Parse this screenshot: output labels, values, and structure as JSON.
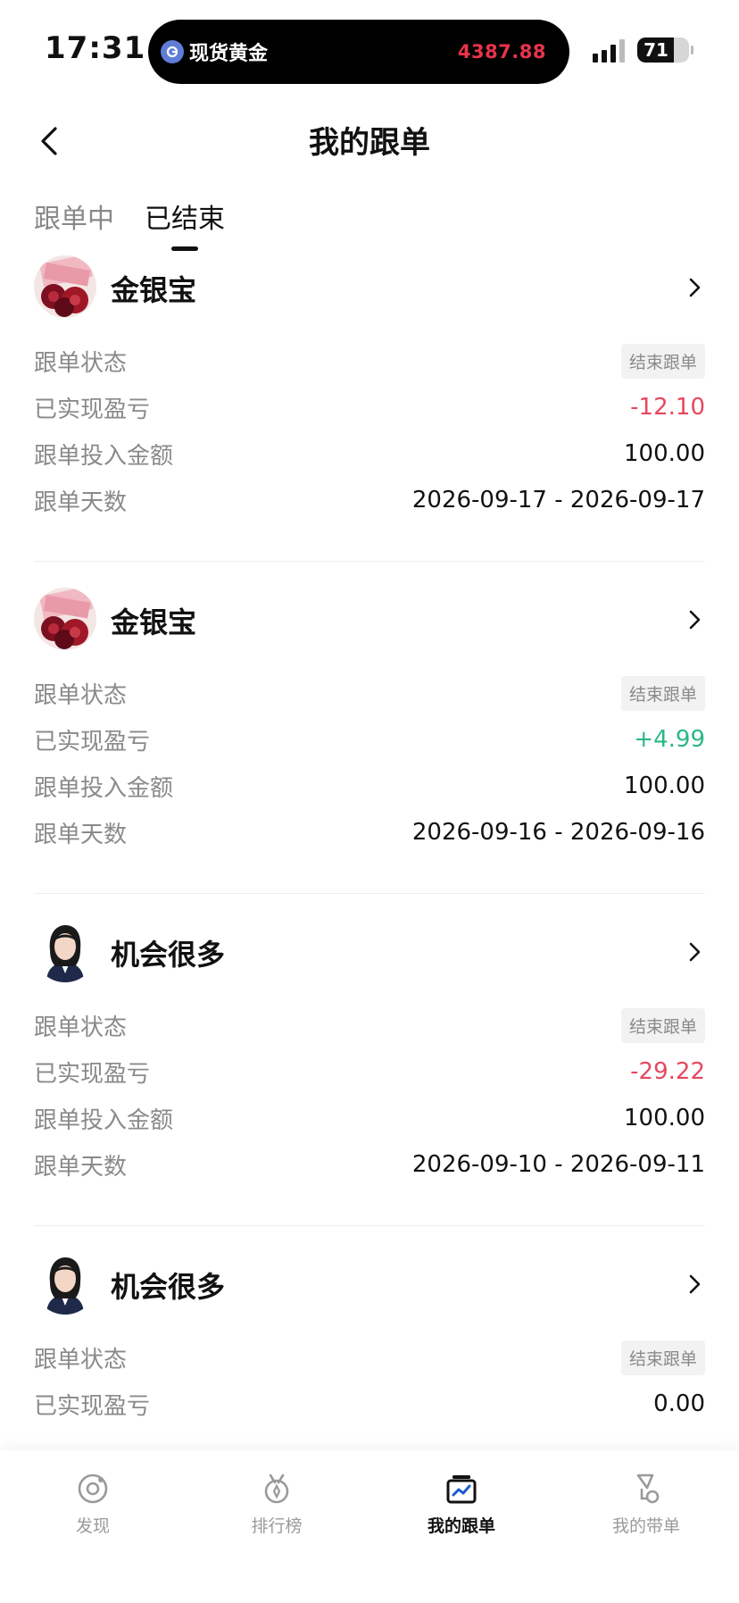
{
  "status_bar": {
    "time": "17:31",
    "island_title": "现货黄金",
    "island_price": "4387.88",
    "battery_level": "71",
    "battery_fraction": 0.71
  },
  "header": {
    "title": "我的跟单"
  },
  "tabs": {
    "ongoing": "跟单中",
    "ended": "已结束",
    "active": "ended"
  },
  "labels": {
    "status": "跟单状态",
    "pnl": "已实现盈亏",
    "amount": "跟单投入金额",
    "days": "跟单天数"
  },
  "cards": [
    {
      "name": "金银宝",
      "avatar": "roses-avatar",
      "status": "结束跟单",
      "pnl": "-12.10",
      "pnl_sign": "neg",
      "amount": "100.00",
      "days": "2026-09-17 - 2026-09-17"
    },
    {
      "name": "金银宝",
      "avatar": "roses-avatar",
      "status": "结束跟单",
      "pnl": "+4.99",
      "pnl_sign": "pos",
      "amount": "100.00",
      "days": "2026-09-16 - 2026-09-16"
    },
    {
      "name": "机会很多",
      "avatar": "portrait-avatar",
      "status": "结束跟单",
      "pnl": "-29.22",
      "pnl_sign": "neg",
      "amount": "100.00",
      "days": "2026-09-10 - 2026-09-11"
    },
    {
      "name": "机会很多",
      "avatar": "portrait-avatar",
      "status": "结束跟单",
      "pnl": "0.00",
      "pnl_sign": "zero"
    }
  ],
  "nav": {
    "discover": "发现",
    "ranking": "排行榜",
    "my_follow": "我的跟单",
    "my_lead": "我的带单",
    "active": "my_follow"
  },
  "colors": {
    "negative": "#e8475f",
    "positive": "#2bb884",
    "island_price": "#e8344b",
    "nav_active_icon": "#1a5ccf"
  }
}
